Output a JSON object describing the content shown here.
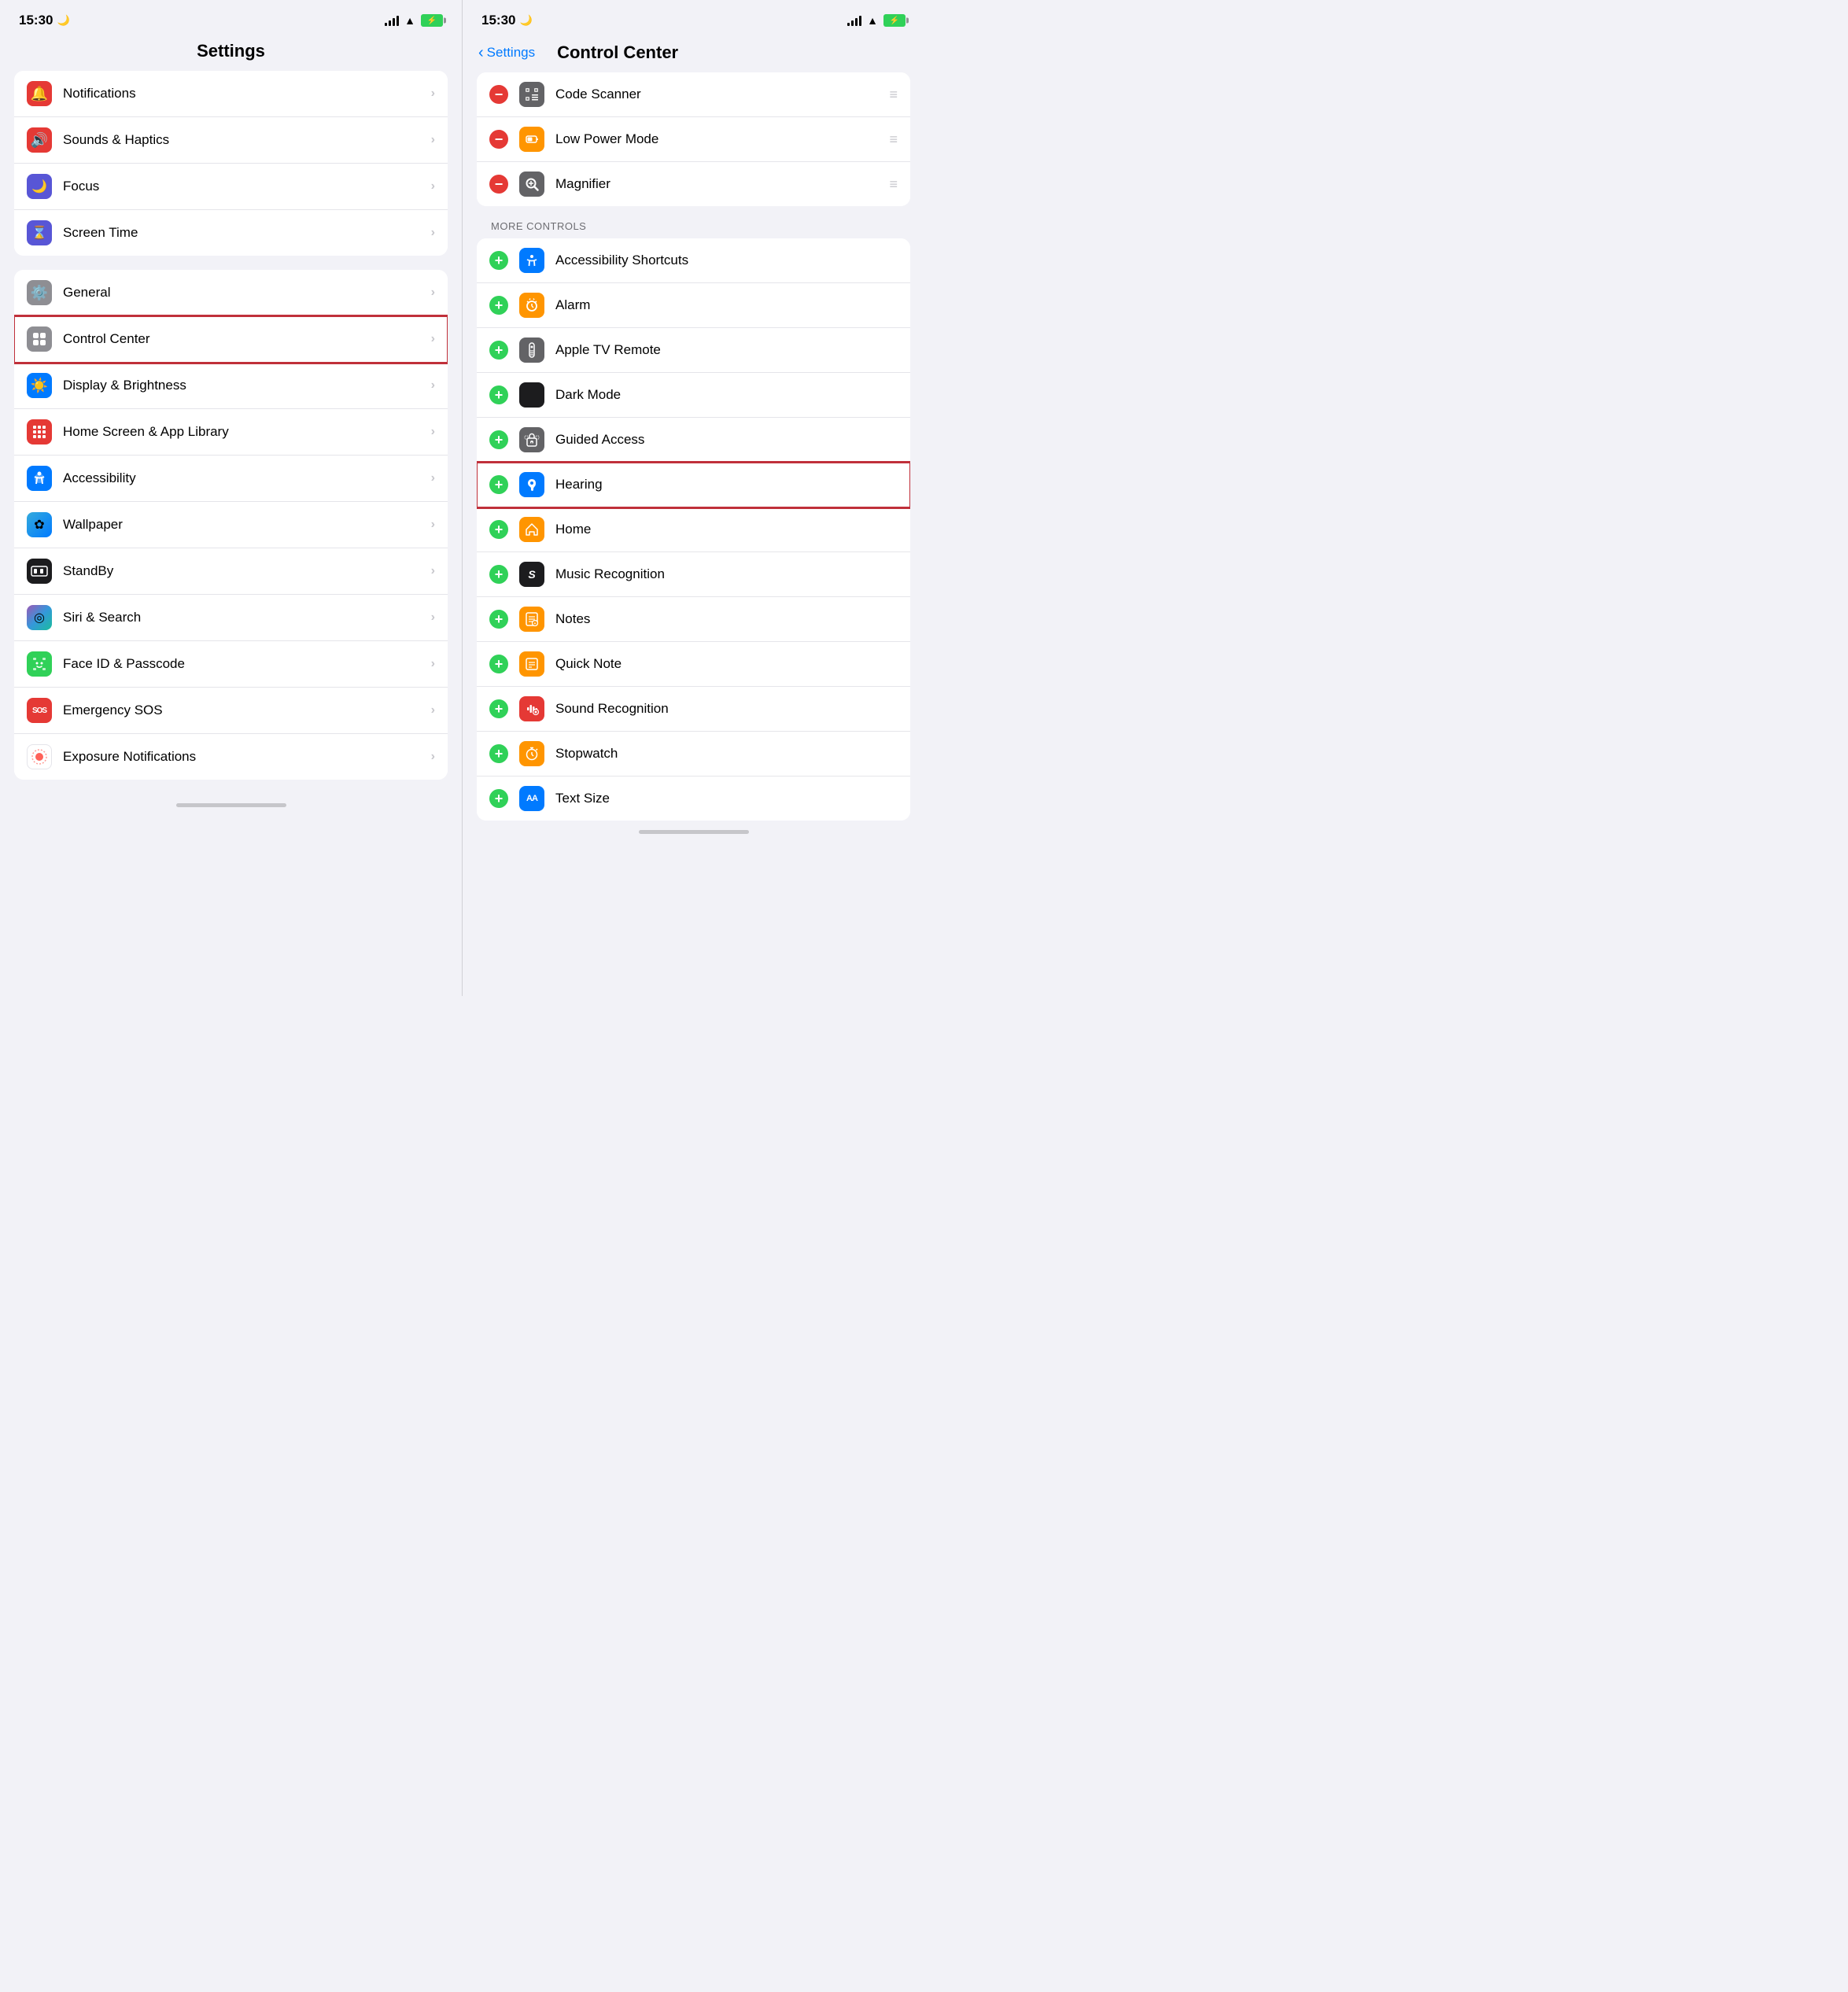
{
  "left_panel": {
    "status": {
      "time": "15:30",
      "moon": "🌙"
    },
    "title": "Settings",
    "groups": [
      {
        "id": "group1",
        "items": [
          {
            "id": "notifications",
            "label": "Notifications",
            "icon_bg": "#e53935",
            "icon": "🔔"
          },
          {
            "id": "sounds",
            "label": "Sounds & Haptics",
            "icon_bg": "#e53935",
            "icon": "🔊"
          },
          {
            "id": "focus",
            "label": "Focus",
            "icon_bg": "#5856d6",
            "icon": "🌙"
          },
          {
            "id": "screen-time",
            "label": "Screen Time",
            "icon_bg": "#5856d6",
            "icon": "⌛"
          }
        ]
      },
      {
        "id": "group2",
        "items": [
          {
            "id": "general",
            "label": "General",
            "icon_bg": "#8e8e93",
            "icon": "⚙️"
          },
          {
            "id": "control-center",
            "label": "Control Center",
            "icon_bg": "#8e8e93",
            "icon": "⊡",
            "highlighted": true
          },
          {
            "id": "display",
            "label": "Display & Brightness",
            "icon_bg": "#007aff",
            "icon": "☀️"
          },
          {
            "id": "home-screen",
            "label": "Home Screen & App Library",
            "icon_bg": "#e53935",
            "icon": "⊞"
          },
          {
            "id": "accessibility",
            "label": "Accessibility",
            "icon_bg": "#007aff",
            "icon": "♿"
          },
          {
            "id": "wallpaper",
            "label": "Wallpaper",
            "icon_bg": "#34aadc",
            "icon": "✿"
          },
          {
            "id": "standby",
            "label": "StandBy",
            "icon_bg": "#1c1c1e",
            "icon": "🌙"
          },
          {
            "id": "siri",
            "label": "Siri & Search",
            "icon_bg": "gradient",
            "icon": "◎"
          },
          {
            "id": "faceid",
            "label": "Face ID & Passcode",
            "icon_bg": "#30d158",
            "icon": "😊"
          },
          {
            "id": "emergency",
            "label": "Emergency SOS",
            "icon_bg": "#e53935",
            "icon": "SOS"
          },
          {
            "id": "exposure",
            "label": "Exposure Notifications",
            "icon_bg": "#ff3b30",
            "icon": "⊙"
          }
        ]
      }
    ]
  },
  "right_panel": {
    "status": {
      "time": "15:30",
      "moon": "🌙"
    },
    "back_label": "Settings",
    "title": "Control Center",
    "included_items": [
      {
        "id": "code-scanner",
        "label": "Code Scanner",
        "icon_bg": "#636366",
        "icon": "⊞"
      },
      {
        "id": "low-power",
        "label": "Low Power Mode",
        "icon_bg": "#ff9500",
        "icon": "🔋"
      },
      {
        "id": "magnifier",
        "label": "Magnifier",
        "icon_bg": "#636366",
        "icon": "🔍"
      }
    ],
    "more_controls_header": "MORE CONTROLS",
    "more_controls": [
      {
        "id": "accessibility-shortcuts",
        "label": "Accessibility Shortcuts",
        "icon_bg": "#007aff",
        "icon": "♿"
      },
      {
        "id": "alarm",
        "label": "Alarm",
        "icon_bg": "#ff9500",
        "icon": "⏰"
      },
      {
        "id": "apple-tv-remote",
        "label": "Apple TV Remote",
        "icon_bg": "#636366",
        "icon": "▶"
      },
      {
        "id": "dark-mode",
        "label": "Dark Mode",
        "icon_bg": "#1c1c1e",
        "icon": "◑"
      },
      {
        "id": "guided-access",
        "label": "Guided Access",
        "icon_bg": "#636366",
        "icon": "🔒"
      },
      {
        "id": "hearing",
        "label": "Hearing",
        "icon_bg": "#007aff",
        "icon": "👂",
        "highlighted": true
      },
      {
        "id": "home",
        "label": "Home",
        "icon_bg": "#ff9500",
        "icon": "🏠"
      },
      {
        "id": "music-recognition",
        "label": "Music Recognition",
        "icon_bg": "#1c1c1e",
        "icon": "S"
      },
      {
        "id": "notes",
        "label": "Notes",
        "icon_bg": "#ff9500",
        "icon": "📝"
      },
      {
        "id": "quick-note",
        "label": "Quick Note",
        "icon_bg": "#ff9500",
        "icon": "📋"
      },
      {
        "id": "sound-recognition",
        "label": "Sound Recognition",
        "icon_bg": "#e53935",
        "icon": "🎵"
      },
      {
        "id": "stopwatch",
        "label": "Stopwatch",
        "icon_bg": "#ff9500",
        "icon": "⏱"
      },
      {
        "id": "text-size",
        "label": "Text Size",
        "icon_bg": "#007aff",
        "icon": "AA"
      }
    ]
  },
  "icons": {
    "chevron": "›",
    "back_chevron": "‹",
    "drag_handle": "≡",
    "plus": "+",
    "minus": "−"
  }
}
